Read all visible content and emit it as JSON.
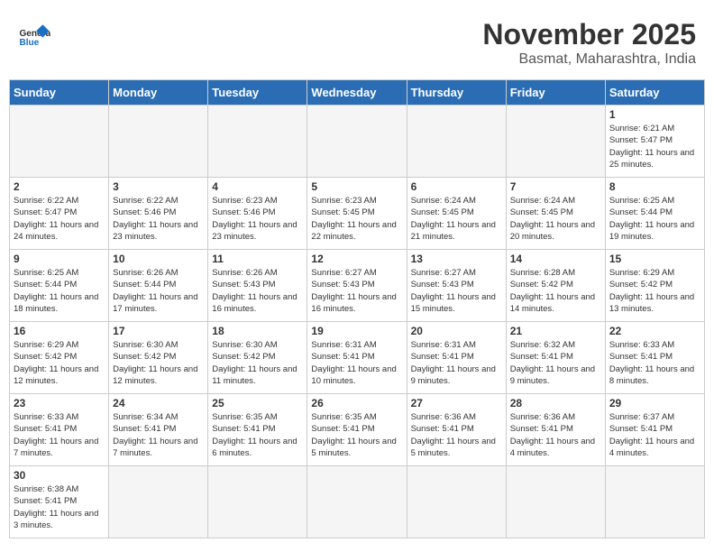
{
  "header": {
    "logo_general": "General",
    "logo_blue": "Blue",
    "title": "November 2025",
    "subtitle": "Basmat, Maharashtra, India"
  },
  "weekdays": [
    "Sunday",
    "Monday",
    "Tuesday",
    "Wednesday",
    "Thursday",
    "Friday",
    "Saturday"
  ],
  "weeks": [
    [
      {
        "day": "",
        "info": ""
      },
      {
        "day": "",
        "info": ""
      },
      {
        "day": "",
        "info": ""
      },
      {
        "day": "",
        "info": ""
      },
      {
        "day": "",
        "info": ""
      },
      {
        "day": "",
        "info": ""
      },
      {
        "day": "1",
        "info": "Sunrise: 6:21 AM\nSunset: 5:47 PM\nDaylight: 11 hours\nand 25 minutes."
      }
    ],
    [
      {
        "day": "2",
        "info": "Sunrise: 6:22 AM\nSunset: 5:47 PM\nDaylight: 11 hours\nand 24 minutes."
      },
      {
        "day": "3",
        "info": "Sunrise: 6:22 AM\nSunset: 5:46 PM\nDaylight: 11 hours\nand 23 minutes."
      },
      {
        "day": "4",
        "info": "Sunrise: 6:23 AM\nSunset: 5:46 PM\nDaylight: 11 hours\nand 23 minutes."
      },
      {
        "day": "5",
        "info": "Sunrise: 6:23 AM\nSunset: 5:45 PM\nDaylight: 11 hours\nand 22 minutes."
      },
      {
        "day": "6",
        "info": "Sunrise: 6:24 AM\nSunset: 5:45 PM\nDaylight: 11 hours\nand 21 minutes."
      },
      {
        "day": "7",
        "info": "Sunrise: 6:24 AM\nSunset: 5:45 PM\nDaylight: 11 hours\nand 20 minutes."
      },
      {
        "day": "8",
        "info": "Sunrise: 6:25 AM\nSunset: 5:44 PM\nDaylight: 11 hours\nand 19 minutes."
      }
    ],
    [
      {
        "day": "9",
        "info": "Sunrise: 6:25 AM\nSunset: 5:44 PM\nDaylight: 11 hours\nand 18 minutes."
      },
      {
        "day": "10",
        "info": "Sunrise: 6:26 AM\nSunset: 5:44 PM\nDaylight: 11 hours\nand 17 minutes."
      },
      {
        "day": "11",
        "info": "Sunrise: 6:26 AM\nSunset: 5:43 PM\nDaylight: 11 hours\nand 16 minutes."
      },
      {
        "day": "12",
        "info": "Sunrise: 6:27 AM\nSunset: 5:43 PM\nDaylight: 11 hours\nand 16 minutes."
      },
      {
        "day": "13",
        "info": "Sunrise: 6:27 AM\nSunset: 5:43 PM\nDaylight: 11 hours\nand 15 minutes."
      },
      {
        "day": "14",
        "info": "Sunrise: 6:28 AM\nSunset: 5:42 PM\nDaylight: 11 hours\nand 14 minutes."
      },
      {
        "day": "15",
        "info": "Sunrise: 6:29 AM\nSunset: 5:42 PM\nDaylight: 11 hours\nand 13 minutes."
      }
    ],
    [
      {
        "day": "16",
        "info": "Sunrise: 6:29 AM\nSunset: 5:42 PM\nDaylight: 11 hours\nand 12 minutes."
      },
      {
        "day": "17",
        "info": "Sunrise: 6:30 AM\nSunset: 5:42 PM\nDaylight: 11 hours\nand 12 minutes."
      },
      {
        "day": "18",
        "info": "Sunrise: 6:30 AM\nSunset: 5:42 PM\nDaylight: 11 hours\nand 11 minutes."
      },
      {
        "day": "19",
        "info": "Sunrise: 6:31 AM\nSunset: 5:41 PM\nDaylight: 11 hours\nand 10 minutes."
      },
      {
        "day": "20",
        "info": "Sunrise: 6:31 AM\nSunset: 5:41 PM\nDaylight: 11 hours\nand 9 minutes."
      },
      {
        "day": "21",
        "info": "Sunrise: 6:32 AM\nSunset: 5:41 PM\nDaylight: 11 hours\nand 9 minutes."
      },
      {
        "day": "22",
        "info": "Sunrise: 6:33 AM\nSunset: 5:41 PM\nDaylight: 11 hours\nand 8 minutes."
      }
    ],
    [
      {
        "day": "23",
        "info": "Sunrise: 6:33 AM\nSunset: 5:41 PM\nDaylight: 11 hours\nand 7 minutes."
      },
      {
        "day": "24",
        "info": "Sunrise: 6:34 AM\nSunset: 5:41 PM\nDaylight: 11 hours\nand 7 minutes."
      },
      {
        "day": "25",
        "info": "Sunrise: 6:35 AM\nSunset: 5:41 PM\nDaylight: 11 hours\nand 6 minutes."
      },
      {
        "day": "26",
        "info": "Sunrise: 6:35 AM\nSunset: 5:41 PM\nDaylight: 11 hours\nand 5 minutes."
      },
      {
        "day": "27",
        "info": "Sunrise: 6:36 AM\nSunset: 5:41 PM\nDaylight: 11 hours\nand 5 minutes."
      },
      {
        "day": "28",
        "info": "Sunrise: 6:36 AM\nSunset: 5:41 PM\nDaylight: 11 hours\nand 4 minutes."
      },
      {
        "day": "29",
        "info": "Sunrise: 6:37 AM\nSunset: 5:41 PM\nDaylight: 11 hours\nand 4 minutes."
      }
    ],
    [
      {
        "day": "30",
        "info": "Sunrise: 6:38 AM\nSunset: 5:41 PM\nDaylight: 11 hours\nand 3 minutes."
      },
      {
        "day": "",
        "info": ""
      },
      {
        "day": "",
        "info": ""
      },
      {
        "day": "",
        "info": ""
      },
      {
        "day": "",
        "info": ""
      },
      {
        "day": "",
        "info": ""
      },
      {
        "day": "",
        "info": ""
      }
    ]
  ]
}
